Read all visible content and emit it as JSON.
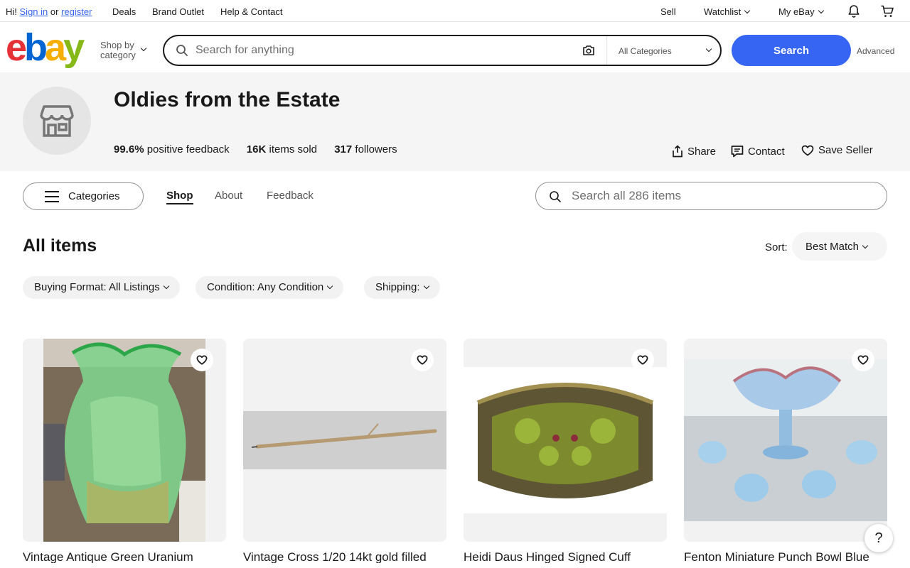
{
  "topbar": {
    "greeting": "Hi!",
    "sign_in": "Sign in",
    "or": "or",
    "register": "register",
    "deals": "Deals",
    "brand_outlet": "Brand Outlet",
    "help": "Help & Contact",
    "sell": "Sell",
    "watchlist": "Watchlist",
    "my_ebay": "My eBay",
    "icons": [
      "bell-icon",
      "cart-icon"
    ]
  },
  "header": {
    "logo": {
      "e": "e",
      "b": "b",
      "a": "a",
      "y": "y",
      "colors": [
        "#e53238",
        "#0064d2",
        "#f5af02",
        "#86b817"
      ]
    },
    "shop_by_line1": "Shop by",
    "shop_by_line2": "category",
    "search_placeholder": "Search for anything",
    "category_select": "All Categories",
    "search_button": "Search",
    "advanced": "Advanced",
    "accent_color": "#3665f3"
  },
  "seller": {
    "name": "Oldies from the Estate",
    "feedback_value": "99.6%",
    "feedback_label": "positive feedback",
    "sold_value": "16K",
    "sold_label": "items sold",
    "followers_value": "317",
    "followers_label": "followers",
    "share": "Share",
    "contact": "Contact",
    "save_seller": "Save Seller"
  },
  "store_nav": {
    "categories": "Categories",
    "tabs": [
      "Shop",
      "About",
      "Feedback"
    ],
    "active_tab": "Shop",
    "search_placeholder": "Search all 286 items"
  },
  "listing": {
    "heading": "All items",
    "sort_label": "Sort:",
    "sort_value": "Best Match",
    "filters": [
      "Buying Format: All Listings",
      "Condition: Any Condition",
      "Shipping:"
    ]
  },
  "products": [
    {
      "title": "Vintage Antique Green Uranium"
    },
    {
      "title": "Vintage Cross 1/20 14kt gold filled"
    },
    {
      "title": "Heidi Daus Hinged Signed Cuff"
    },
    {
      "title": "Fenton Miniature Punch Bowl Blue"
    }
  ],
  "help_button": "?"
}
